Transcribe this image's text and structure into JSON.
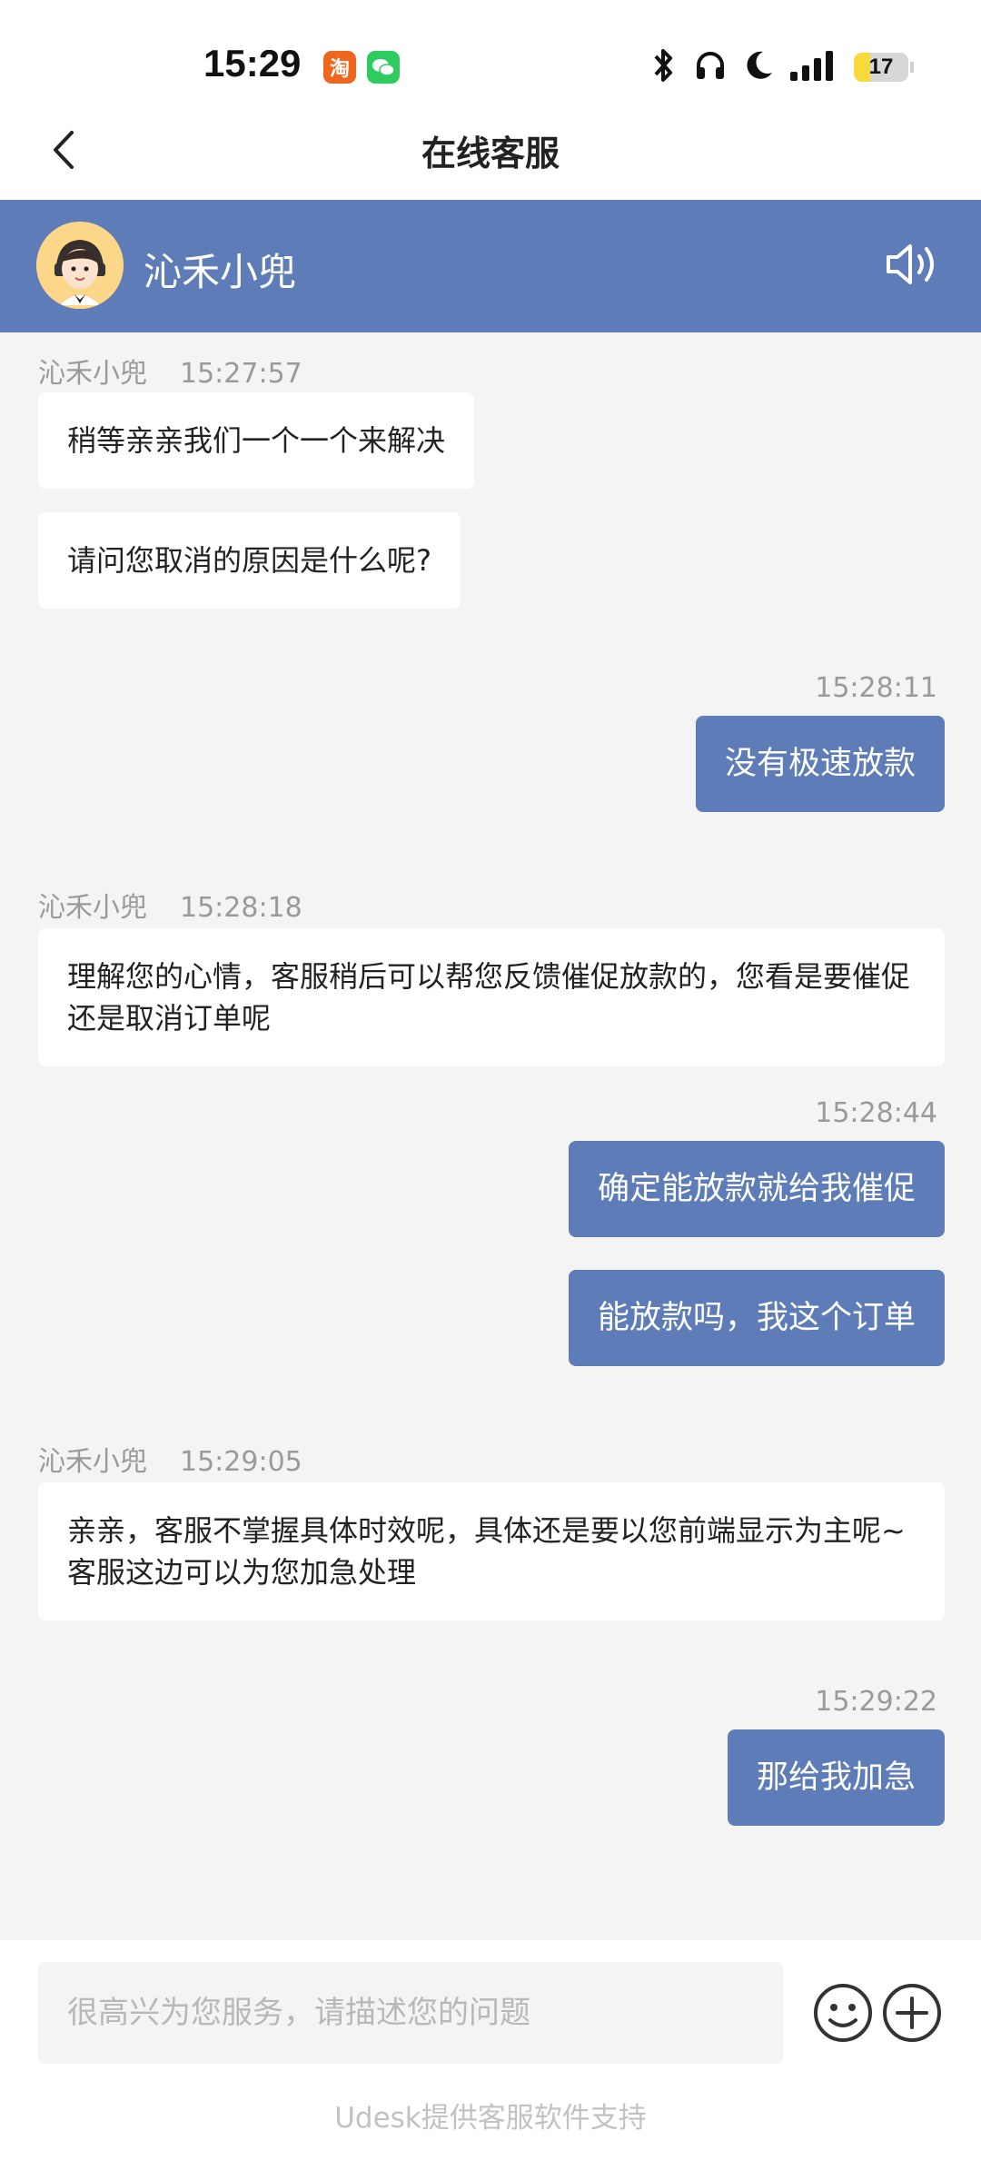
{
  "status_bar": {
    "time": "15:29",
    "app_icons": [
      "taobao-icon",
      "wechat-icon"
    ],
    "battery_level": "17",
    "indicators": [
      "bluetooth-icon",
      "headphones-icon",
      "moon-icon",
      "signal-icon"
    ]
  },
  "nav": {
    "title": "在线客服"
  },
  "agent": {
    "name": "沁禾小兜"
  },
  "colors": {
    "accent": "#5d7cb8",
    "background": "#f4f4f4",
    "bubble_in": "#ffffff"
  },
  "messages": [
    {
      "side": "in",
      "sender": "沁禾小兜",
      "time": "15:27:57",
      "text": "稍等亲亲我们一个一个来解决"
    },
    {
      "side": "in",
      "text": "请问您取消的原因是什么呢?"
    },
    {
      "side": "out",
      "time": "15:28:11",
      "text": "没有极速放款"
    },
    {
      "side": "in",
      "sender": "沁禾小兜",
      "time": "15:28:18",
      "text": "理解您的心情，客服稍后可以帮您反馈催促放款的，您看是要催促还是取消订单呢"
    },
    {
      "side": "out",
      "time": "15:28:44",
      "text": "确定能放款就给我催促"
    },
    {
      "side": "out",
      "text": "能放款吗，我这个订单"
    },
    {
      "side": "in",
      "sender": "沁禾小兜",
      "time": "15:29:05",
      "text": "亲亲，客服不掌握具体时效呢，具体还是要以您前端显示为主呢~客服这边可以为您加急处理"
    },
    {
      "side": "out",
      "time": "15:29:22",
      "text": "那给我加急"
    }
  ],
  "input": {
    "placeholder": "很高兴为您服务，请描述您的问题",
    "value": ""
  },
  "footer": {
    "note": "Udesk提供客服软件支持"
  }
}
